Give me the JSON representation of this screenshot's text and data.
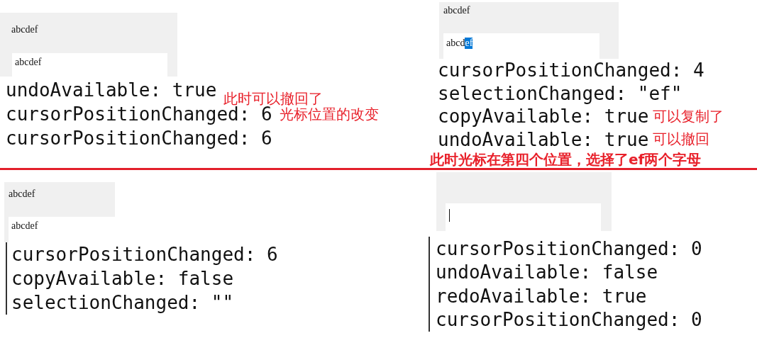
{
  "panels": [
    {
      "label": "abcdef",
      "field": {
        "segments": [
          {
            "text": "abcdef",
            "selected": false
          }
        ],
        "caret": false
      },
      "gutter": false,
      "log": [
        {
          "text": "undoAvailable: true",
          "note": "此时可以撤回了"
        },
        {
          "text": "cursorPositionChanged: 6",
          "note": "光标位置的改变"
        },
        {
          "text": "cursorPositionChanged: 6"
        }
      ]
    },
    {
      "label": "abcdef",
      "field": {
        "segments": [
          {
            "text": "abcd",
            "selected": false
          },
          {
            "text": "ef",
            "selected": true
          }
        ],
        "caret": false
      },
      "gutter": false,
      "log": [
        {
          "text": "cursorPositionChanged: 4"
        },
        {
          "text": "selectionChanged: \"ef\""
        },
        {
          "text": "copyAvailable: true",
          "note": "可以复制了"
        },
        {
          "text": "undoAvailable: true",
          "note": "可以撤回"
        }
      ],
      "caption": "此时光标在第四个位置，选择了ef两个字母"
    },
    {
      "label": "abcdef",
      "field": {
        "segments": [
          {
            "text": "abcdef",
            "selected": false
          }
        ],
        "caret": false
      },
      "gutter": true,
      "log": [
        {
          "text": "cursorPositionChanged: 6"
        },
        {
          "text": "copyAvailable: false"
        },
        {
          "text": "selectionChanged: \"\""
        }
      ]
    },
    {
      "field": {
        "caret": true
      },
      "gutter": true,
      "log": [
        {
          "text": "cursorPositionChanged: 0"
        },
        {
          "text": "undoAvailable: false"
        },
        {
          "text": "redoAvailable: true"
        },
        {
          "text": "cursorPositionChanged: 0"
        }
      ]
    }
  ]
}
